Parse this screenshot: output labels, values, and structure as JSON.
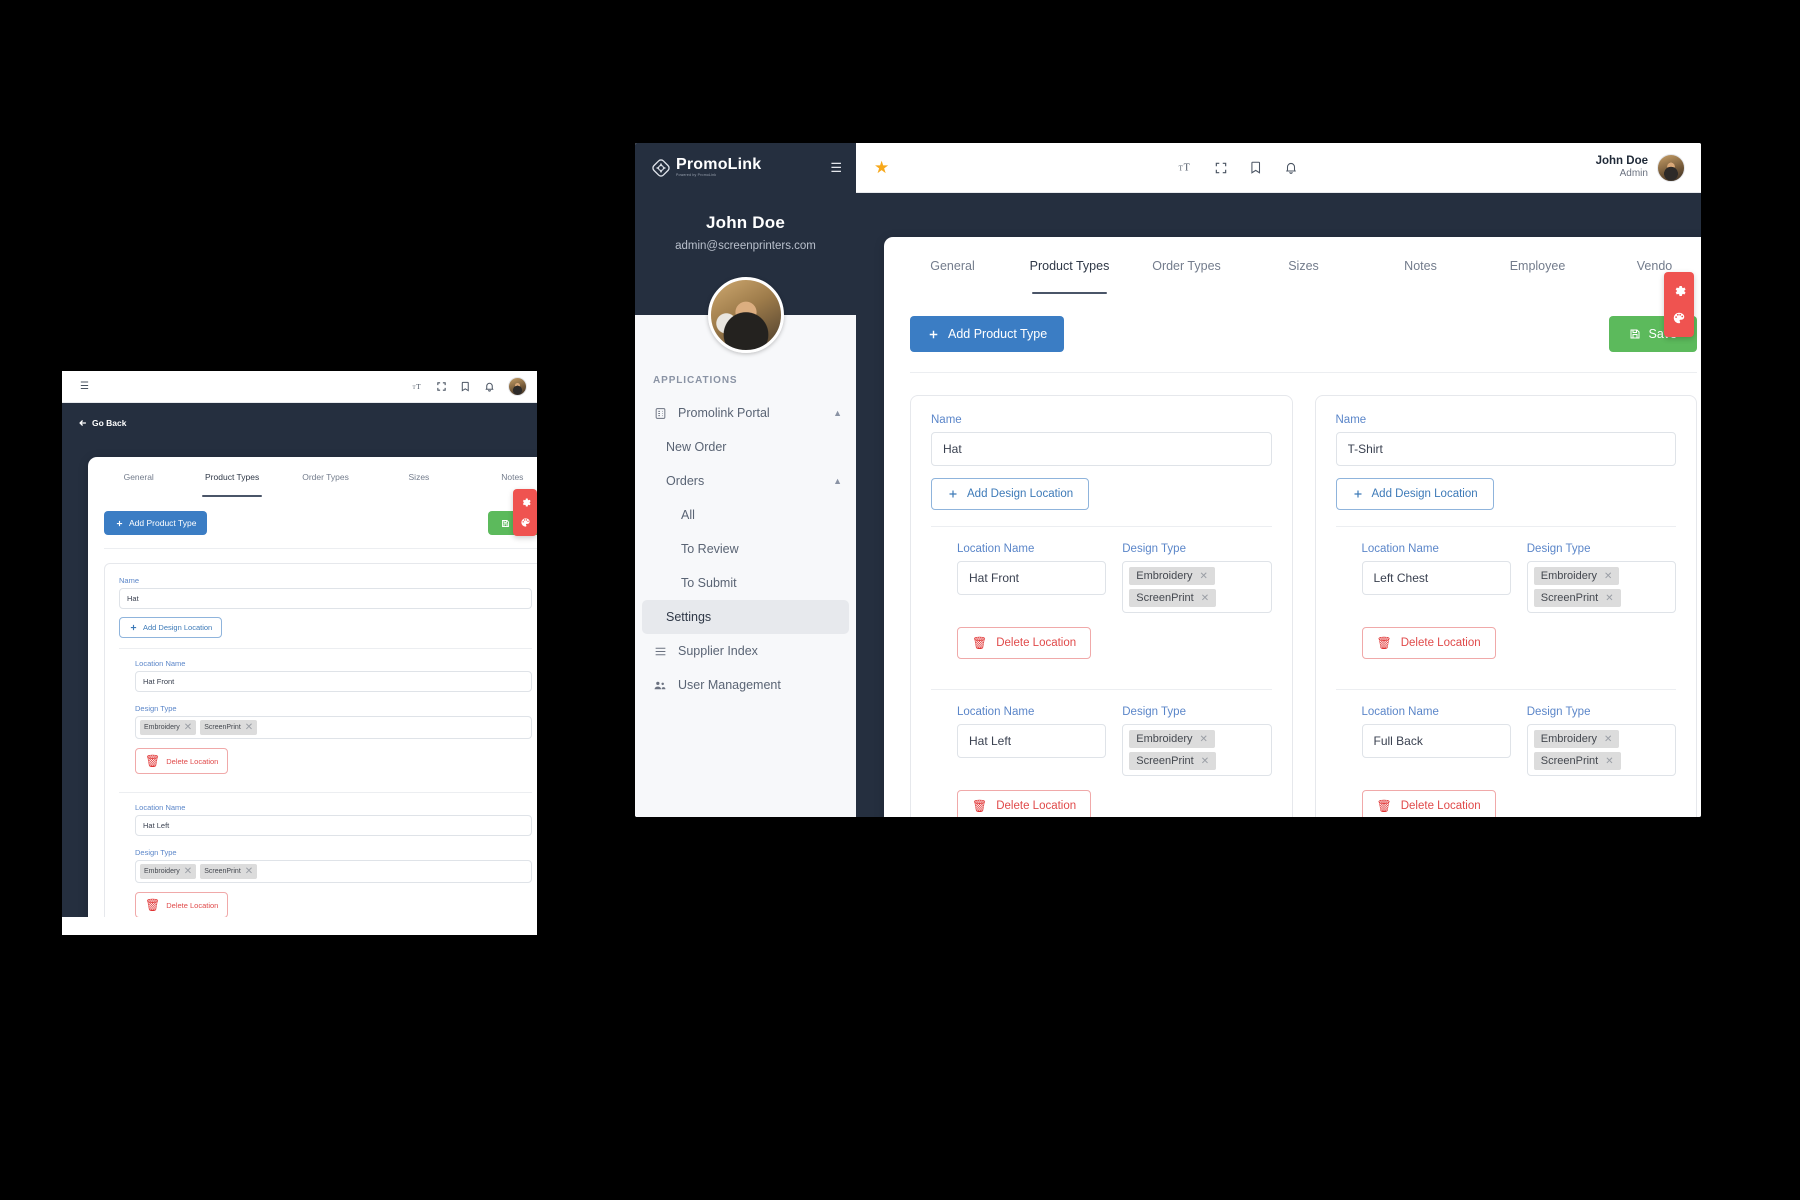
{
  "brand": {
    "name": "PromoLink",
    "tagline": "Powered by PromoLink",
    "logo_icon": "promolink-logo-icon",
    "hamburger_icon": "hamburger-menu-icon"
  },
  "topbar": {
    "star_icon": "star-icon",
    "icons": [
      {
        "name": "text-size-icon",
        "label": "tT"
      },
      {
        "name": "fullscreen-icon",
        "label": ""
      },
      {
        "name": "bookmark-icon",
        "label": ""
      },
      {
        "name": "bell-icon",
        "label": ""
      }
    ],
    "user": {
      "name": "John Doe",
      "role": "Admin",
      "avatar": "user-avatar"
    }
  },
  "sidebar": {
    "profile": {
      "name": "John Doe",
      "email": "admin@screenprinters.com",
      "avatar": "profile-avatar"
    },
    "section_label": "APPLICATIONS",
    "items": [
      {
        "label": "Promolink Portal",
        "level": 1,
        "icon": "portal-icon",
        "chevron": "chevron-up-icon",
        "active": false
      },
      {
        "label": "New Order",
        "level": 2,
        "icon": "",
        "chevron": "",
        "active": false
      },
      {
        "label": "Orders",
        "level": 2,
        "icon": "",
        "chevron": "chevron-up-icon",
        "active": false
      },
      {
        "label": "All",
        "level": 3,
        "icon": "",
        "chevron": "",
        "active": false
      },
      {
        "label": "To Review",
        "level": 3,
        "icon": "",
        "chevron": "",
        "active": false
      },
      {
        "label": "To Submit",
        "level": 3,
        "icon": "",
        "chevron": "",
        "active": false
      },
      {
        "label": "Settings",
        "level": 2,
        "icon": "",
        "chevron": "",
        "active": true
      },
      {
        "label": "Supplier Index",
        "level": 1,
        "icon": "list-icon",
        "chevron": "",
        "active": false
      },
      {
        "label": "User Management",
        "level": 1,
        "icon": "users-icon",
        "chevron": "",
        "active": false
      }
    ]
  },
  "content": {
    "go_back_label": "Go Back",
    "go_back_icon": "arrow-left-icon",
    "tabs": [
      {
        "label": "General",
        "active": false
      },
      {
        "label": "Product Types",
        "active": true
      },
      {
        "label": "Order Types",
        "active": false
      },
      {
        "label": "Sizes",
        "active": false
      },
      {
        "label": "Notes",
        "active": false
      },
      {
        "label": "Employee",
        "active": false
      },
      {
        "label": "Vendo",
        "active": false
      }
    ],
    "tabs_small": [
      {
        "label": "General",
        "active": false
      },
      {
        "label": "Product Types",
        "active": true
      },
      {
        "label": "Order Types",
        "active": false
      },
      {
        "label": "Sizes",
        "active": false
      },
      {
        "label": "Notes",
        "active": false
      }
    ],
    "add_product_type_label": "Add Product Type",
    "add_product_type_icon": "plus-icon",
    "save_label": "Save",
    "save_icon": "save-disk-icon",
    "field_labels": {
      "name": "Name",
      "location_name": "Location Name",
      "design_type": "Design Type"
    },
    "add_design_location_label": "Add Design Location",
    "add_design_location_icon": "plus-icon",
    "delete_location_label": "Delete Location",
    "delete_location_icon": "trash-icon",
    "chip_remove_icon": "close-x-icon",
    "product_types": [
      {
        "name": "Hat",
        "locations": [
          {
            "location_name": "Hat Front",
            "design_types": [
              "Embroidery",
              "ScreenPrint"
            ]
          },
          {
            "location_name": "Hat Left",
            "design_types": [
              "Embroidery",
              "ScreenPrint"
            ]
          },
          {
            "location_name": "",
            "design_types": [],
            "headers_only": true
          }
        ]
      },
      {
        "name": "T-Shirt",
        "locations": [
          {
            "location_name": "Left Chest",
            "design_types": [
              "Embroidery",
              "ScreenPrint"
            ]
          },
          {
            "location_name": "Full Back",
            "design_types": [
              "Embroidery",
              "ScreenPrint"
            ]
          },
          {
            "location_name": "",
            "design_types": [],
            "headers_only": true
          }
        ]
      }
    ]
  },
  "float_panel": {
    "icons": [
      {
        "name": "gear-settings-icon"
      },
      {
        "name": "color-palette-icon"
      }
    ],
    "color": "#ef5350"
  },
  "colors": {
    "dark_navy": "#252f3f",
    "primary_blue": "#3b7dc4",
    "success_green": "#5cba5c",
    "danger_red": "#e04a4a",
    "accent_red": "#ef5350",
    "star_amber": "#f7a81b",
    "label_blue": "#5b86c9"
  }
}
